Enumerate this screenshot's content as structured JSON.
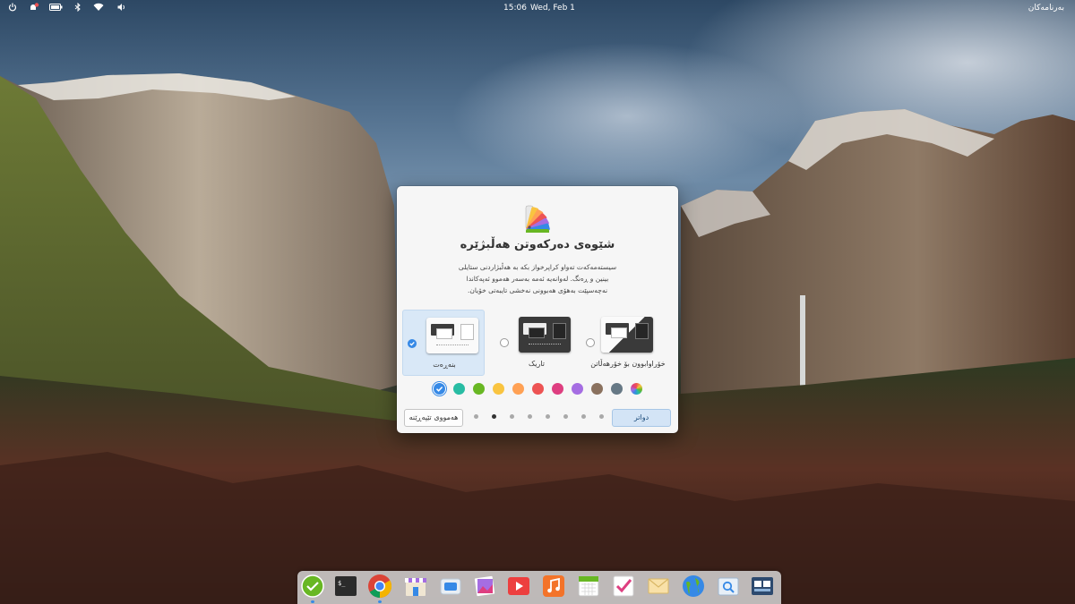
{
  "panel": {
    "time": "15:06",
    "date": "Wed, Feb  1",
    "applications_label": "بەرنامەکان",
    "indicators": [
      "power-icon",
      "notifications-icon",
      "battery-icon",
      "bluetooth-icon",
      "wifi-icon",
      "volume-icon"
    ]
  },
  "dialog": {
    "title": "شێوەی دەرکەوتن هەڵبژێرە",
    "description_line1": "سیستەمەکەت تەواو کراپرخواز بکە بە هەڵبژاردنی ستایلی",
    "description_line2": "بینین و ڕەنگ. لەوانەیە ئەمە بەسەر هەموو ئەپەکاندا",
    "description_line3": "نەچەسپێت بەهۆی هەبوونی نەخشی تایبەتی خۆیان.",
    "styles": [
      {
        "label": "بنەڕەت",
        "selected": true
      },
      {
        "label": "تاریک",
        "selected": false
      },
      {
        "label": "خۆراوابوون بۆ خۆرهەڵاتن",
        "selected": false
      }
    ],
    "accent_colors": [
      "#3689e6",
      "#28bca3",
      "#68b723",
      "#f9c440",
      "#ffa154",
      "#ed5353",
      "#de3e80",
      "#a56de2",
      "#8a715e",
      "#667885",
      "multi"
    ],
    "selected_accent": "#3689e6",
    "page_count": 8,
    "current_page": 2,
    "next_button": "دواتر",
    "skip_button": "هەمووی تێپەڕێنە"
  },
  "dock": {
    "apps": [
      "tasks-icon",
      "terminal-icon",
      "chrome-icon",
      "appcenter-icon",
      "files-icon",
      "photos-icon",
      "videos-icon",
      "music-icon",
      "calendar-icon",
      "tasks-check-icon",
      "mail-icon",
      "web-browser-icon",
      "search-icon",
      "screenshot-icon"
    ]
  }
}
